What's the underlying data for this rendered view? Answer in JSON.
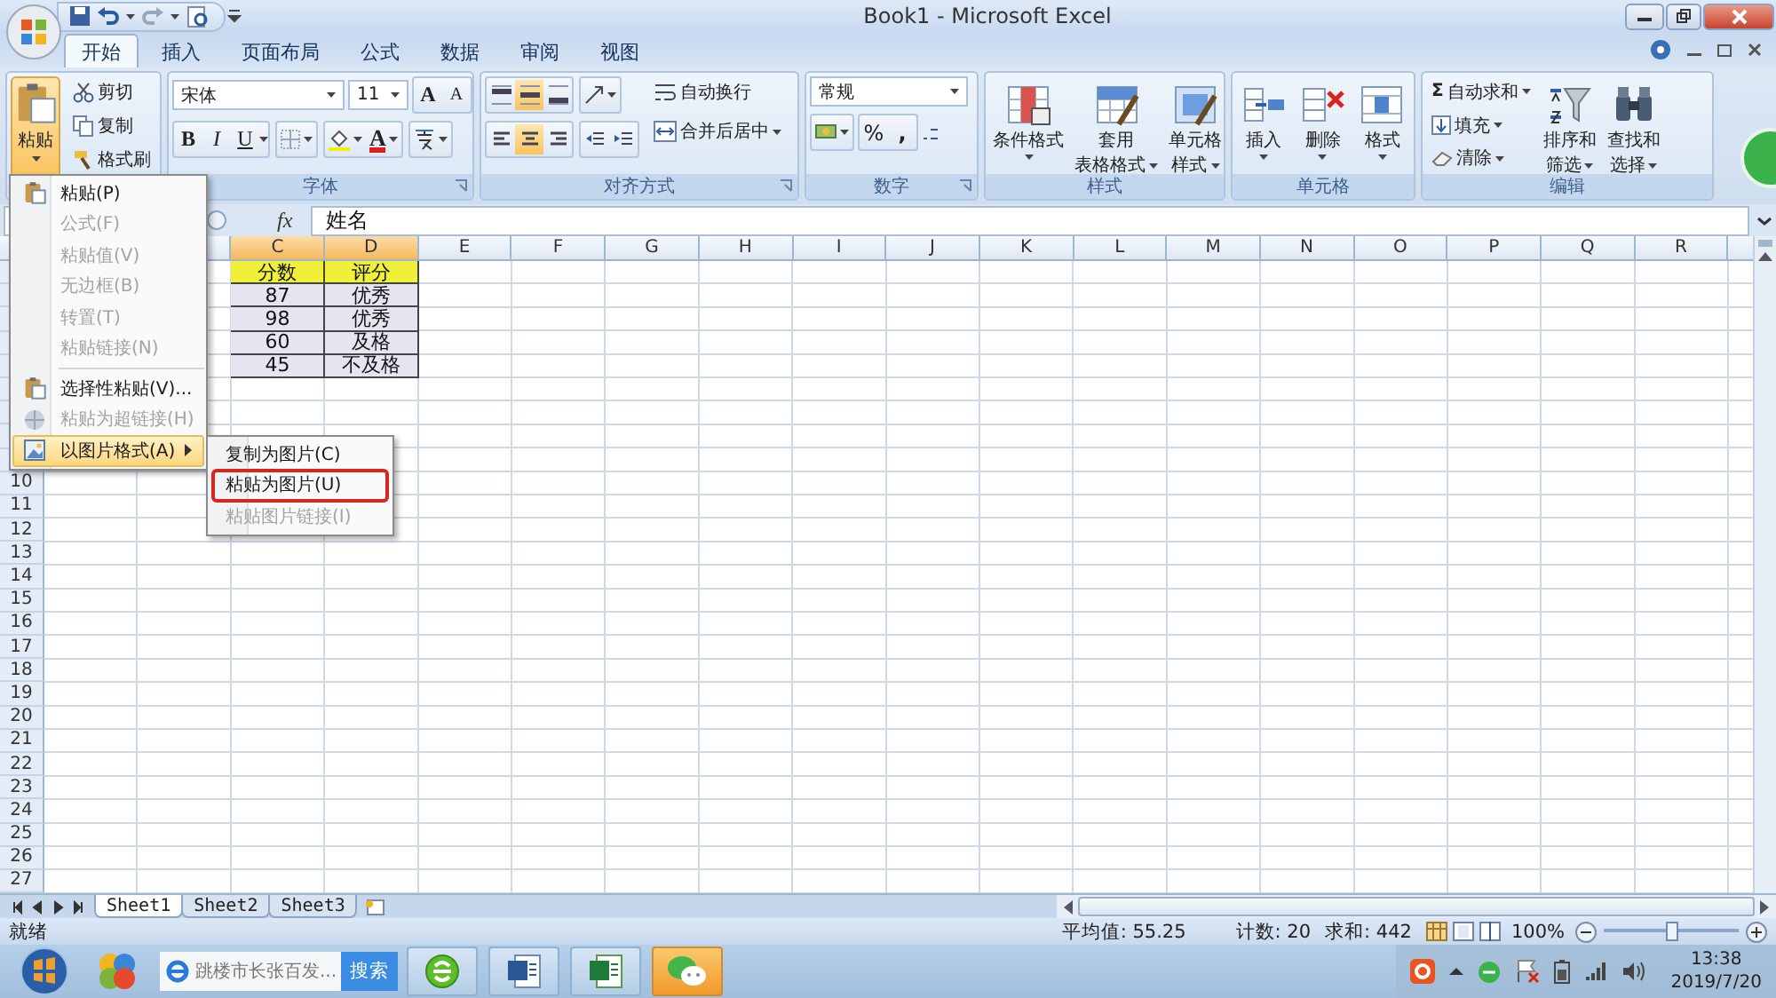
{
  "window": {
    "title": "Book1 - Microsoft Excel"
  },
  "ribbon_tabs": [
    {
      "label": "开始",
      "selected": true
    },
    {
      "label": "插入",
      "selected": false
    },
    {
      "label": "页面布局",
      "selected": false
    },
    {
      "label": "公式",
      "selected": false
    },
    {
      "label": "数据",
      "selected": false
    },
    {
      "label": "审阅",
      "selected": false
    },
    {
      "label": "视图",
      "selected": false
    }
  ],
  "ribbon": {
    "clipboard": {
      "paste": "粘贴",
      "items": [
        "剪切",
        "复制",
        "格式刷"
      ]
    },
    "font": {
      "label": "字体",
      "font_name": "宋体",
      "font_size": "11",
      "grow": "A",
      "shrink": "A",
      "bold": "B",
      "italic": "I",
      "underline": "U",
      "font_color": "A"
    },
    "alignment": {
      "label": "对齐方式",
      "wrap": "自动换行",
      "merge": "合并后居中"
    },
    "number": {
      "label": "数字",
      "format": "常规",
      "percent": "%",
      "comma": ","
    },
    "styles": {
      "label": "样式",
      "buttons": [
        {
          "kind": "conditional",
          "lines": [
            "条件格式"
          ]
        },
        {
          "kind": "table",
          "lines": [
            "套用",
            "表格格式"
          ]
        },
        {
          "kind": "cellstyle",
          "lines": [
            "单元格",
            "样式"
          ]
        }
      ]
    },
    "cells": {
      "label": "单元格",
      "buttons": [
        {
          "kind": "insert",
          "lines": [
            "插入"
          ]
        },
        {
          "kind": "delete",
          "lines": [
            "删除"
          ]
        },
        {
          "kind": "format",
          "lines": [
            "格式"
          ]
        }
      ]
    },
    "editing": {
      "label": "编辑",
      "sum_symbol": "Σ",
      "autosum": "自动求和",
      "fill": "填充",
      "clear": "清除",
      "big": [
        {
          "kind": "sort",
          "lines": [
            "排序和",
            "筛选"
          ]
        },
        {
          "kind": "find",
          "lines": [
            "查找和",
            "选择"
          ]
        }
      ]
    }
  },
  "formula_bar": {
    "function_label": "fx",
    "value": "姓名"
  },
  "sheet": {
    "columns": [
      {
        "label": "C",
        "selected": true
      },
      {
        "label": "D",
        "selected": true
      },
      {
        "label": "E",
        "selected": false
      },
      {
        "label": "F",
        "selected": false
      },
      {
        "label": "G",
        "selected": false
      },
      {
        "label": "H",
        "selected": false
      },
      {
        "label": "I",
        "selected": false
      },
      {
        "label": "J",
        "selected": false
      },
      {
        "label": "K",
        "selected": false
      },
      {
        "label": "L",
        "selected": false
      },
      {
        "label": "M",
        "selected": false
      },
      {
        "label": "N",
        "selected": false
      },
      {
        "label": "O",
        "selected": false
      },
      {
        "label": "P",
        "selected": false
      },
      {
        "label": "Q",
        "selected": false
      },
      {
        "label": "R",
        "selected": false
      }
    ],
    "row_numbers": [
      "10",
      "11",
      "12",
      "13",
      "14",
      "15",
      "16",
      "17",
      "18",
      "19",
      "20",
      "21",
      "22",
      "23",
      "24",
      "25",
      "26",
      "27"
    ],
    "cells": [
      {
        "kind": "header",
        "values": [
          "分数",
          "评分"
        ]
      },
      {
        "kind": "data",
        "values": [
          "87",
          "优秀"
        ]
      },
      {
        "kind": "data",
        "values": [
          "98",
          "优秀"
        ]
      },
      {
        "kind": "data",
        "values": [
          "60",
          "及格"
        ]
      },
      {
        "kind": "data",
        "values": [
          "45",
          "不及格"
        ]
      }
    ]
  },
  "sheet_tabs": [
    {
      "label": "Sheet1",
      "selected": true
    },
    {
      "label": "Sheet2",
      "selected": false
    },
    {
      "label": "Sheet3",
      "selected": false
    }
  ],
  "status_bar": {
    "ready": "就绪",
    "average": "平均值: 55.25",
    "count": "计数: 20",
    "sum": "求和: 442",
    "zoom": "100%",
    "zoom_slider": {
      "level": 0.5
    }
  },
  "paste_menu": {
    "items": [
      {
        "kind": "clipboard",
        "label": "粘贴(P)",
        "disabled": false,
        "highlighted": false
      },
      {
        "kind": "text",
        "label": "公式(F)",
        "disabled": true,
        "highlighted": false
      },
      {
        "kind": "text",
        "label": "粘贴值(V)",
        "disabled": true,
        "highlighted": false
      },
      {
        "kind": "text",
        "label": "无边框(B)",
        "disabled": true,
        "highlighted": false
      },
      {
        "kind": "text",
        "label": "转置(T)",
        "disabled": true,
        "highlighted": false
      },
      {
        "kind": "text",
        "label": "粘贴链接(N)",
        "disabled": true,
        "highlighted": false
      },
      {
        "kind": "separator"
      },
      {
        "kind": "clipboard",
        "label": "选择性粘贴(V)...",
        "disabled": false,
        "highlighted": false
      },
      {
        "kind": "link",
        "label": "粘贴为超链接(H)",
        "disabled": true,
        "highlighted": false
      },
      {
        "kind": "submenu",
        "label": "以图片格式(A)",
        "disabled": false,
        "highlighted": true
      }
    ]
  },
  "picture_submenu": {
    "items": [
      {
        "label": "复制为图片(C)",
        "disabled": false,
        "outlined": false
      },
      {
        "label": "粘贴为图片(U)",
        "disabled": false,
        "outlined": true
      },
      {
        "label": "粘贴图片链接(I)",
        "disabled": true,
        "outlined": false
      }
    ]
  },
  "taskbar": {
    "search_text": "跳楼市长张百发...",
    "search_button": "搜索",
    "apps": [
      {
        "kind": "browser",
        "active": false
      },
      {
        "kind": "word",
        "active": false
      },
      {
        "kind": "excel",
        "active": false
      },
      {
        "kind": "wechat",
        "active": true
      }
    ],
    "time": "13:38",
    "date": "2019/7/20"
  }
}
